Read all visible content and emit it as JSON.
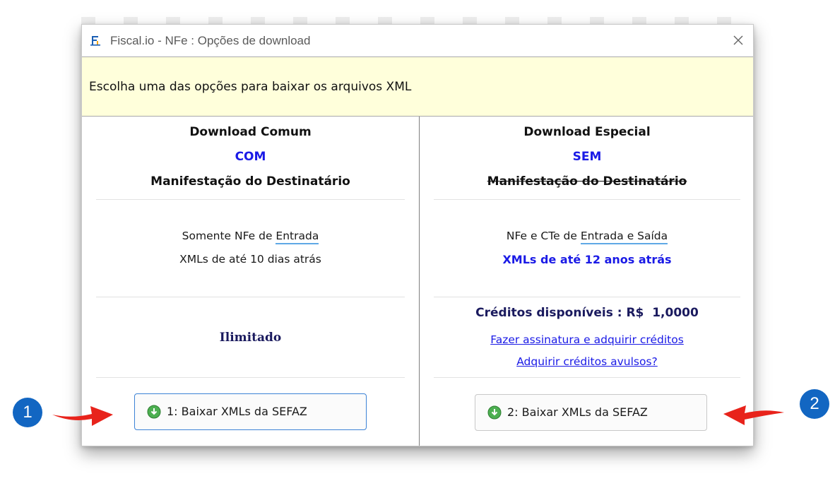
{
  "window": {
    "title": "Fiscal.io - NFe : Opções de download",
    "app_icon": "fiscal-io-logo-icon",
    "close_icon": "close-icon"
  },
  "notice": {
    "text": "Escolha uma das opções para baixar os arquivos XML",
    "background": "#ffffdb"
  },
  "left": {
    "title": "Download Comum",
    "mode": "COM",
    "subtitle": "Manifestação do Destinatário",
    "line1_prefix": "Somente NFe de ",
    "line1_highlight": "Entrada",
    "line2": "XMLs de até 10 dias atrás",
    "limit": "Ilimitado",
    "button_label": "1: Baixar XMLs da SEFAZ",
    "button_icon": "download-circle-icon"
  },
  "right": {
    "title": "Download Especial",
    "mode": "SEM",
    "subtitle": "Manifestação do Destinatário",
    "line1_prefix": "NFe e CTe de ",
    "line1_highlight": "Entrada e Saída",
    "line2": "XMLs de até 12 anos atrás",
    "credits": "Créditos disponíveis : R$  1,0000",
    "link_subscribe": "Fazer assinatura e adquirir créditos",
    "link_buy": "Adquirir créditos avulsos?",
    "button_label": "2: Baixar XMLs da SEFAZ",
    "button_icon": "download-circle-icon"
  },
  "annotations": {
    "badge1": "1",
    "badge2": "2",
    "badge_color": "#1266c2",
    "arrow_color": "#e8231b"
  },
  "colors": {
    "accent_blue": "#1a1ae6",
    "navy": "#1a1a5e",
    "button_focus_border": "#3c82d6",
    "download_icon_green": "#4caf50"
  }
}
